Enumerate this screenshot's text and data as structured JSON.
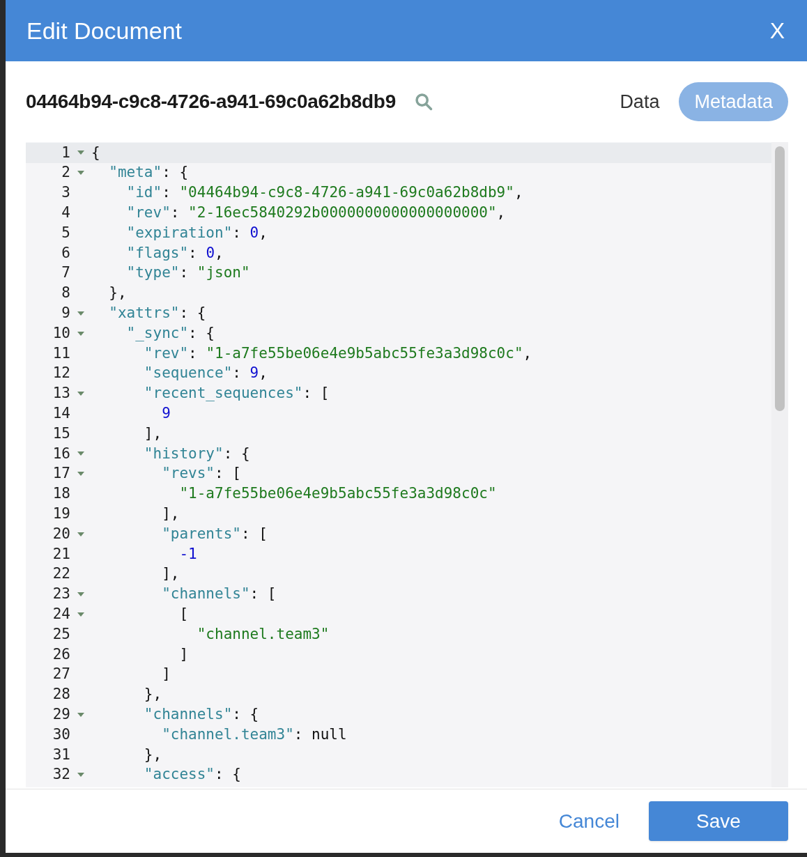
{
  "dialog": {
    "title": "Edit Document",
    "close": "X"
  },
  "document_id": "04464b94-c9c8-4726-a941-69c0a62b8db9",
  "tabs": [
    {
      "label": "Data",
      "selected": false
    },
    {
      "label": "Metadata",
      "selected": true
    }
  ],
  "editor": {
    "lines": [
      {
        "number": "1",
        "foldable": true,
        "active": true,
        "tokens": [
          {
            "kind": "punct",
            "text": "{"
          }
        ]
      },
      {
        "number": "2",
        "foldable": true,
        "active": false,
        "tokens": [
          {
            "kind": "key",
            "text": "  \"meta\""
          },
          {
            "kind": "punct",
            "text": ": {"
          }
        ]
      },
      {
        "number": "3",
        "foldable": false,
        "active": false,
        "tokens": [
          {
            "kind": "key",
            "text": "    \"id\""
          },
          {
            "kind": "punct",
            "text": ": "
          },
          {
            "kind": "string",
            "text": "\"04464b94-c9c8-4726-a941-69c0a62b8db9\""
          },
          {
            "kind": "punct",
            "text": ","
          }
        ]
      },
      {
        "number": "4",
        "foldable": false,
        "active": false,
        "tokens": [
          {
            "kind": "key",
            "text": "    \"rev\""
          },
          {
            "kind": "punct",
            "text": ": "
          },
          {
            "kind": "string",
            "text": "\"2-16ec5840292b0000000000000000000\""
          },
          {
            "kind": "punct",
            "text": ","
          }
        ]
      },
      {
        "number": "5",
        "foldable": false,
        "active": false,
        "tokens": [
          {
            "kind": "key",
            "text": "    \"expiration\""
          },
          {
            "kind": "punct",
            "text": ": "
          },
          {
            "kind": "number",
            "text": "0"
          },
          {
            "kind": "punct",
            "text": ","
          }
        ]
      },
      {
        "number": "6",
        "foldable": false,
        "active": false,
        "tokens": [
          {
            "kind": "key",
            "text": "    \"flags\""
          },
          {
            "kind": "punct",
            "text": ": "
          },
          {
            "kind": "number",
            "text": "0"
          },
          {
            "kind": "punct",
            "text": ","
          }
        ]
      },
      {
        "number": "7",
        "foldable": false,
        "active": false,
        "tokens": [
          {
            "kind": "key",
            "text": "    \"type\""
          },
          {
            "kind": "punct",
            "text": ": "
          },
          {
            "kind": "string",
            "text": "\"json\""
          }
        ]
      },
      {
        "number": "8",
        "foldable": false,
        "active": false,
        "tokens": [
          {
            "kind": "punct",
            "text": "  },"
          }
        ]
      },
      {
        "number": "9",
        "foldable": true,
        "active": false,
        "tokens": [
          {
            "kind": "key",
            "text": "  \"xattrs\""
          },
          {
            "kind": "punct",
            "text": ": {"
          }
        ]
      },
      {
        "number": "10",
        "foldable": true,
        "active": false,
        "tokens": [
          {
            "kind": "key",
            "text": "    \"_sync\""
          },
          {
            "kind": "punct",
            "text": ": {"
          }
        ]
      },
      {
        "number": "11",
        "foldable": false,
        "active": false,
        "tokens": [
          {
            "kind": "key",
            "text": "      \"rev\""
          },
          {
            "kind": "punct",
            "text": ": "
          },
          {
            "kind": "string",
            "text": "\"1-a7fe55be06e4e9b5abc55fe3a3d98c0c\""
          },
          {
            "kind": "punct",
            "text": ","
          }
        ]
      },
      {
        "number": "12",
        "foldable": false,
        "active": false,
        "tokens": [
          {
            "kind": "key",
            "text": "      \"sequence\""
          },
          {
            "kind": "punct",
            "text": ": "
          },
          {
            "kind": "number",
            "text": "9"
          },
          {
            "kind": "punct",
            "text": ","
          }
        ]
      },
      {
        "number": "13",
        "foldable": true,
        "active": false,
        "tokens": [
          {
            "kind": "key",
            "text": "      \"recent_sequences\""
          },
          {
            "kind": "punct",
            "text": ": ["
          }
        ]
      },
      {
        "number": "14",
        "foldable": false,
        "active": false,
        "tokens": [
          {
            "kind": "number",
            "text": "        9"
          }
        ]
      },
      {
        "number": "15",
        "foldable": false,
        "active": false,
        "tokens": [
          {
            "kind": "punct",
            "text": "      ],"
          }
        ]
      },
      {
        "number": "16",
        "foldable": true,
        "active": false,
        "tokens": [
          {
            "kind": "key",
            "text": "      \"history\""
          },
          {
            "kind": "punct",
            "text": ": {"
          }
        ]
      },
      {
        "number": "17",
        "foldable": true,
        "active": false,
        "tokens": [
          {
            "kind": "key",
            "text": "        \"revs\""
          },
          {
            "kind": "punct",
            "text": ": ["
          }
        ]
      },
      {
        "number": "18",
        "foldable": false,
        "active": false,
        "tokens": [
          {
            "kind": "string",
            "text": "          \"1-a7fe55be06e4e9b5abc55fe3a3d98c0c\""
          }
        ]
      },
      {
        "number": "19",
        "foldable": false,
        "active": false,
        "tokens": [
          {
            "kind": "punct",
            "text": "        ],"
          }
        ]
      },
      {
        "number": "20",
        "foldable": true,
        "active": false,
        "tokens": [
          {
            "kind": "key",
            "text": "        \"parents\""
          },
          {
            "kind": "punct",
            "text": ": ["
          }
        ]
      },
      {
        "number": "21",
        "foldable": false,
        "active": false,
        "tokens": [
          {
            "kind": "number",
            "text": "          -1"
          }
        ]
      },
      {
        "number": "22",
        "foldable": false,
        "active": false,
        "tokens": [
          {
            "kind": "punct",
            "text": "        ],"
          }
        ]
      },
      {
        "number": "23",
        "foldable": true,
        "active": false,
        "tokens": [
          {
            "kind": "key",
            "text": "        \"channels\""
          },
          {
            "kind": "punct",
            "text": ": ["
          }
        ]
      },
      {
        "number": "24",
        "foldable": true,
        "active": false,
        "tokens": [
          {
            "kind": "punct",
            "text": "          ["
          }
        ]
      },
      {
        "number": "25",
        "foldable": false,
        "active": false,
        "tokens": [
          {
            "kind": "string",
            "text": "            \"channel.team3\""
          }
        ]
      },
      {
        "number": "26",
        "foldable": false,
        "active": false,
        "tokens": [
          {
            "kind": "punct",
            "text": "          ]"
          }
        ]
      },
      {
        "number": "27",
        "foldable": false,
        "active": false,
        "tokens": [
          {
            "kind": "punct",
            "text": "        ]"
          }
        ]
      },
      {
        "number": "28",
        "foldable": false,
        "active": false,
        "tokens": [
          {
            "kind": "punct",
            "text": "      },"
          }
        ]
      },
      {
        "number": "29",
        "foldable": true,
        "active": false,
        "tokens": [
          {
            "kind": "key",
            "text": "      \"channels\""
          },
          {
            "kind": "punct",
            "text": ": {"
          }
        ]
      },
      {
        "number": "30",
        "foldable": false,
        "active": false,
        "tokens": [
          {
            "kind": "key",
            "text": "        \"channel.team3\""
          },
          {
            "kind": "punct",
            "text": ": null"
          }
        ]
      },
      {
        "number": "31",
        "foldable": false,
        "active": false,
        "tokens": [
          {
            "kind": "punct",
            "text": "      },"
          }
        ]
      },
      {
        "number": "32",
        "foldable": true,
        "active": false,
        "tokens": [
          {
            "kind": "key",
            "text": "      \"access\""
          },
          {
            "kind": "punct",
            "text": ": {"
          }
        ]
      }
    ]
  },
  "buttons": [
    {
      "kind": "link",
      "label": "Cancel"
    },
    {
      "kind": "primary",
      "label": "Save"
    }
  ]
}
